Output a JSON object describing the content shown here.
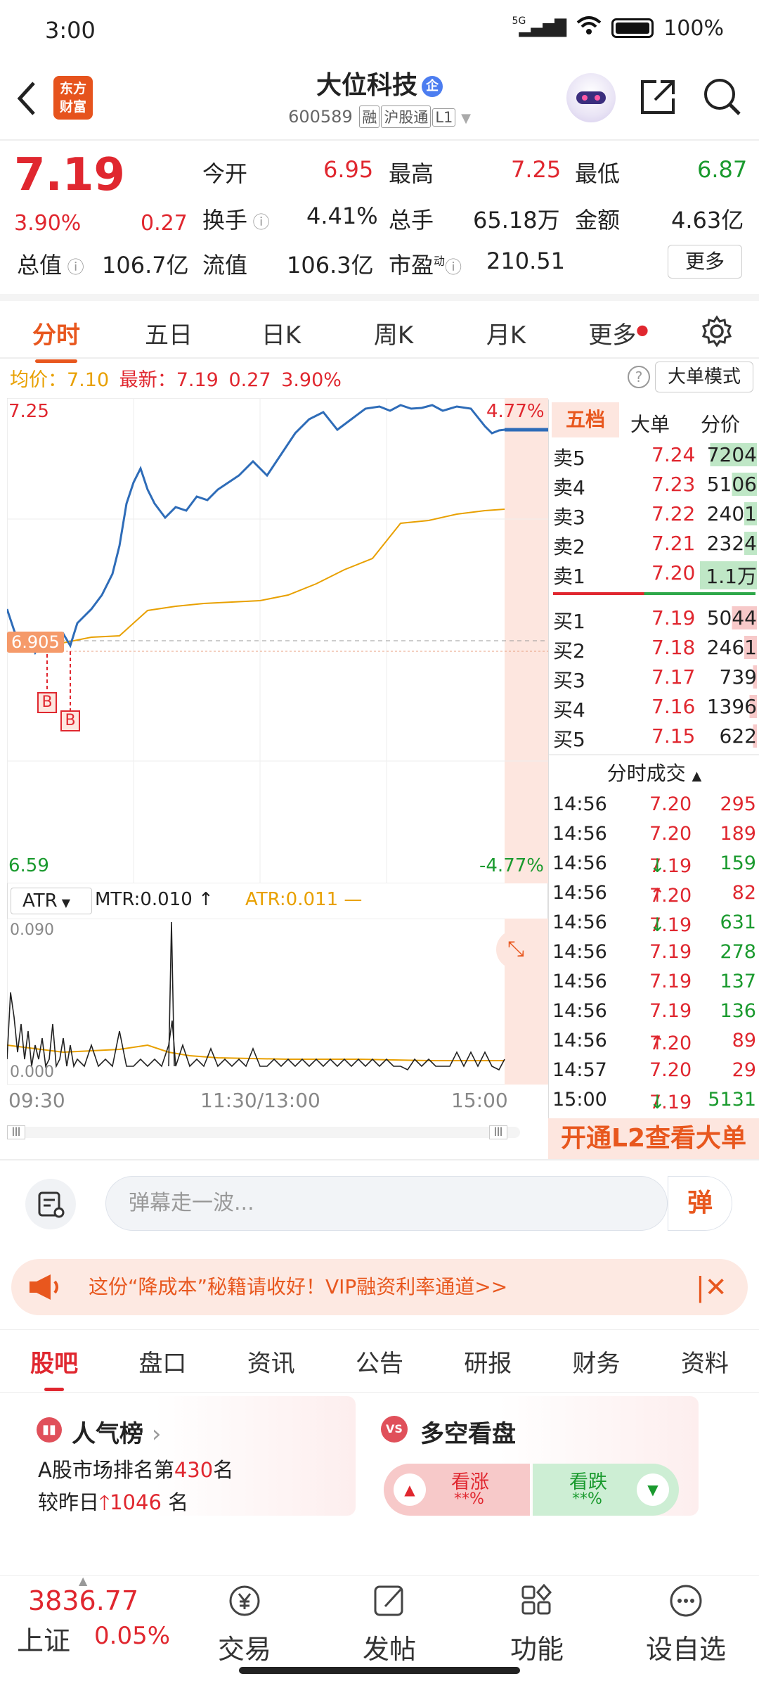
{
  "status_bar": {
    "time": "3:00",
    "network": "5G",
    "battery": "100%"
  },
  "header": {
    "logo_text": "东方财富",
    "stock_name": "大位科技",
    "badge": "企",
    "code": "600589",
    "tags": [
      "融",
      "沪股通",
      "L1"
    ]
  },
  "quote": {
    "price": "7.19",
    "change_pct": "3.90%",
    "change": "0.27",
    "stats": [
      {
        "label": "今开",
        "value": "6.95",
        "color": "red"
      },
      {
        "label": "最高",
        "value": "7.25",
        "color": "red"
      },
      {
        "label": "最低",
        "value": "6.87",
        "color": "green"
      },
      {
        "label": "换手",
        "value": "4.41%",
        "color": "black"
      },
      {
        "label": "总手",
        "value": "65.18万",
        "color": "black"
      },
      {
        "label": "金额",
        "value": "4.63亿",
        "color": "black"
      },
      {
        "label": "总值",
        "value": "106.7亿",
        "color": "black"
      },
      {
        "label": "流值",
        "value": "106.3亿",
        "color": "black"
      },
      {
        "label": "市盈",
        "value": "210.51",
        "color": "black"
      }
    ],
    "pe_superscript": "动",
    "more_label": "更多"
  },
  "chart_tabs": [
    "分时",
    "五日",
    "日K",
    "周K",
    "月K",
    "更多"
  ],
  "info_line": {
    "avg_label": "均价：",
    "avg_value": "7.10",
    "latest_label": "最新：",
    "latest_value": "7.19",
    "change": "0.27",
    "change_pct": "3.90%",
    "mode_button": "大单模式"
  },
  "chart_labels": {
    "high": "7.25",
    "low": "6.59",
    "high_pct": "4.77%",
    "low_pct": "-4.77%",
    "ref_price": "6.905",
    "marker": "B"
  },
  "atr": {
    "select": "ATR",
    "mtr": "MTR:0.010",
    "atr": "ATR:0.011",
    "ymax": "0.090",
    "ymin": "0.000",
    "x_labels": [
      "09:30",
      "11:30/13:00",
      "15:00"
    ]
  },
  "order_book": {
    "tabs": [
      "五档",
      "大单",
      "分价"
    ],
    "asks": [
      {
        "label": "卖5",
        "price": "7.24",
        "vol": "7204"
      },
      {
        "label": "卖4",
        "price": "7.23",
        "vol": "5106"
      },
      {
        "label": "卖3",
        "price": "7.22",
        "vol": "2401"
      },
      {
        "label": "卖2",
        "price": "7.21",
        "vol": "2324"
      },
      {
        "label": "卖1",
        "price": "7.20",
        "vol": "1.1万"
      }
    ],
    "bids": [
      {
        "label": "买1",
        "price": "7.19",
        "vol": "5044"
      },
      {
        "label": "买2",
        "price": "7.18",
        "vol": "2461"
      },
      {
        "label": "买3",
        "price": "7.17",
        "vol": "739"
      },
      {
        "label": "买4",
        "price": "7.16",
        "vol": "1396"
      },
      {
        "label": "买5",
        "price": "7.15",
        "vol": "622"
      }
    ],
    "trades_title": "分时成交",
    "trades": [
      {
        "time": "14:56",
        "price": "7.20",
        "arrow": "",
        "vol": "295",
        "color": "red"
      },
      {
        "time": "14:56",
        "price": "7.20",
        "arrow": "",
        "vol": "189",
        "color": "red"
      },
      {
        "time": "14:56",
        "price": "7.19",
        "arrow": "↓",
        "vol": "159",
        "color": "green"
      },
      {
        "time": "14:56",
        "price": "7.20",
        "arrow": "↑",
        "vol": "82",
        "color": "red"
      },
      {
        "time": "14:56",
        "price": "7.19",
        "arrow": "↓",
        "vol": "631",
        "color": "green"
      },
      {
        "time": "14:56",
        "price": "7.19",
        "arrow": "",
        "vol": "278",
        "color": "green"
      },
      {
        "time": "14:56",
        "price": "7.19",
        "arrow": "",
        "vol": "137",
        "color": "green"
      },
      {
        "time": "14:56",
        "price": "7.19",
        "arrow": "",
        "vol": "136",
        "color": "green"
      },
      {
        "time": "14:56",
        "price": "7.20",
        "arrow": "↑",
        "vol": "89",
        "color": "red"
      },
      {
        "time": "14:57",
        "price": "7.20",
        "arrow": "",
        "vol": "29",
        "color": "red"
      },
      {
        "time": "15:00",
        "price": "7.19",
        "arrow": "↓",
        "vol": "5131",
        "color": "green"
      }
    ],
    "l2_promo": "开通L2查看大单"
  },
  "comment": {
    "placeholder": "弹幕走一波...",
    "danmu_button": "弹"
  },
  "banner": {
    "text": "这份“降成本”秘籍请收好！VIP融资利率通道>>"
  },
  "sub_tabs": [
    "股吧",
    "盘口",
    "资讯",
    "公告",
    "研报",
    "财务",
    "资料"
  ],
  "popularity": {
    "title": "人气榜",
    "rank_prefix": "A股市场排名第",
    "rank": "430",
    "rank_suffix": "名",
    "change_prefix": "较昨日",
    "change": "1046",
    "change_suffix": "名"
  },
  "sentiment": {
    "title": "多空看盘",
    "up_label": "看涨",
    "down_label": "看跌",
    "up_value": "**%",
    "down_value": "**%"
  },
  "index": {
    "name": "上证",
    "value": "3836.77",
    "change": "0.05%"
  },
  "bottom_nav": [
    "交易",
    "发帖",
    "功能",
    "设自选"
  ]
}
